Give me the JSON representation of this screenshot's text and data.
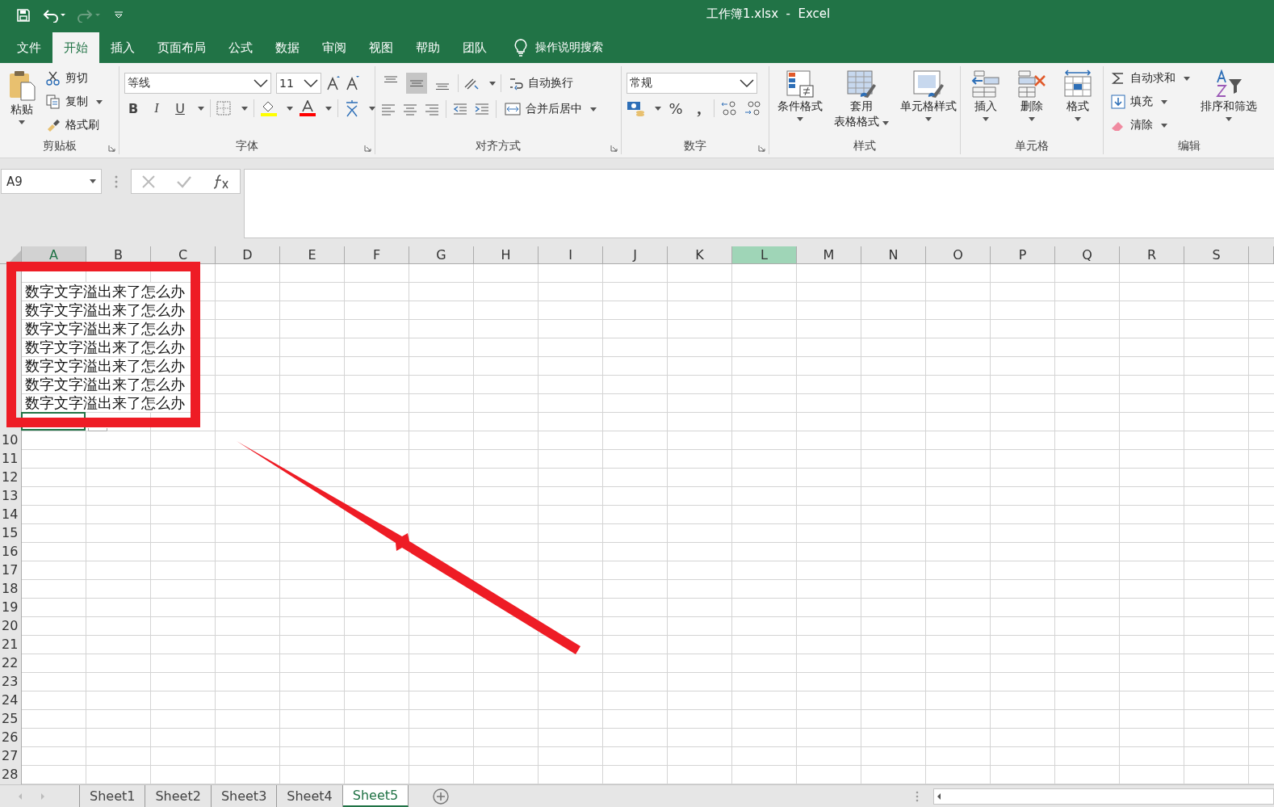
{
  "window": {
    "title": "工作簿1.xlsx  -  Excel"
  },
  "ribbon_tabs": [
    {
      "label": "文件",
      "selected": false
    },
    {
      "label": "开始",
      "selected": true
    },
    {
      "label": "插入",
      "selected": false
    },
    {
      "label": "页面布局",
      "selected": false
    },
    {
      "label": "公式",
      "selected": false
    },
    {
      "label": "数据",
      "selected": false
    },
    {
      "label": "审阅",
      "selected": false
    },
    {
      "label": "视图",
      "selected": false
    },
    {
      "label": "帮助",
      "selected": false
    },
    {
      "label": "团队",
      "selected": false
    }
  ],
  "tell_me": {
    "placeholder": "操作说明搜索"
  },
  "clipboard": {
    "label": "剪贴板",
    "paste": "粘贴",
    "cut": "剪切",
    "copy": "复制",
    "format_painter": "格式刷"
  },
  "font": {
    "label": "字体",
    "font_name": "等线",
    "font_size": "11",
    "bold": "B",
    "italic": "I",
    "underline": "U"
  },
  "alignment": {
    "label": "对齐方式",
    "vertical_align": [
      {
        "selected": false
      },
      {
        "selected": true
      },
      {
        "selected": false
      }
    ],
    "wrap_text": "自动换行",
    "merge_center": "合并后居中"
  },
  "number": {
    "label": "数字",
    "format": "常规",
    "percent": "%",
    "comma": ","
  },
  "styles": {
    "label": "样式",
    "conditional": "条件格式",
    "format_as_table": [
      "套用",
      "表格格式"
    ],
    "cell_styles": "单元格样式"
  },
  "cells": {
    "label": "单元格",
    "insert": "插入",
    "delete": "删除",
    "format": "格式"
  },
  "editing": {
    "label": "编辑",
    "autosum": "自动求和",
    "fill": "填充",
    "clear": "清除",
    "sort_filter": "排序和筛选"
  },
  "name_box": {
    "value": "A9"
  },
  "columns": [
    {
      "letter": "A",
      "selected": true,
      "highlighted": false
    },
    {
      "letter": "B",
      "selected": false,
      "highlighted": false
    },
    {
      "letter": "C",
      "selected": false,
      "highlighted": false
    },
    {
      "letter": "D",
      "selected": false,
      "highlighted": false
    },
    {
      "letter": "E",
      "selected": false,
      "highlighted": false
    },
    {
      "letter": "F",
      "selected": false,
      "highlighted": false
    },
    {
      "letter": "G",
      "selected": false,
      "highlighted": false
    },
    {
      "letter": "H",
      "selected": false,
      "highlighted": false
    },
    {
      "letter": "I",
      "selected": false,
      "highlighted": false
    },
    {
      "letter": "J",
      "selected": false,
      "highlighted": false
    },
    {
      "letter": "K",
      "selected": false,
      "highlighted": false
    },
    {
      "letter": "L",
      "selected": false,
      "highlighted": true
    },
    {
      "letter": "M",
      "selected": false,
      "highlighted": false
    },
    {
      "letter": "N",
      "selected": false,
      "highlighted": false
    },
    {
      "letter": "O",
      "selected": false,
      "highlighted": false
    },
    {
      "letter": "P",
      "selected": false,
      "highlighted": false
    },
    {
      "letter": "Q",
      "selected": false,
      "highlighted": false
    },
    {
      "letter": "R",
      "selected": false,
      "highlighted": false
    },
    {
      "letter": "S",
      "selected": false,
      "highlighted": false
    }
  ],
  "rows": [
    {
      "selected": false
    },
    {
      "selected": false,
      "text": "数字文字溢出来了怎么办"
    },
    {
      "selected": false,
      "text": "数字文字溢出来了怎么办"
    },
    {
      "selected": false,
      "text": "数字文字溢出来了怎么办"
    },
    {
      "selected": false,
      "text": "数字文字溢出来了怎么办"
    },
    {
      "selected": false,
      "text": "数字文字溢出来了怎么办"
    },
    {
      "selected": false,
      "text": "数字文字溢出来了怎么办"
    },
    {
      "selected": false,
      "text": "数字文字溢出来了怎么办"
    },
    {
      "selected": true
    },
    {
      "selected": false,
      "number": "10"
    },
    {
      "selected": false,
      "number": "11"
    },
    {
      "selected": false,
      "number": "12"
    },
    {
      "selected": false,
      "number": "13"
    },
    {
      "selected": false,
      "number": "14"
    },
    {
      "selected": false,
      "number": "15"
    },
    {
      "selected": false,
      "number": "16"
    },
    {
      "selected": false,
      "number": "17"
    },
    {
      "selected": false,
      "number": "18"
    },
    {
      "selected": false,
      "number": "19"
    },
    {
      "selected": false,
      "number": "20"
    },
    {
      "selected": false,
      "number": "21"
    },
    {
      "selected": false,
      "number": "22"
    },
    {
      "selected": false,
      "number": "23"
    },
    {
      "selected": false,
      "number": "24"
    },
    {
      "selected": false,
      "number": "25"
    },
    {
      "selected": false,
      "number": "26"
    },
    {
      "selected": false,
      "number": "27"
    },
    {
      "selected": false,
      "number": "28"
    }
  ],
  "sheets": [
    {
      "label": "Sheet1",
      "selected": false
    },
    {
      "label": "Sheet2",
      "selected": false
    },
    {
      "label": "Sheet3",
      "selected": false
    },
    {
      "label": "Sheet4",
      "selected": false
    },
    {
      "label": "Sheet5",
      "selected": true
    }
  ]
}
